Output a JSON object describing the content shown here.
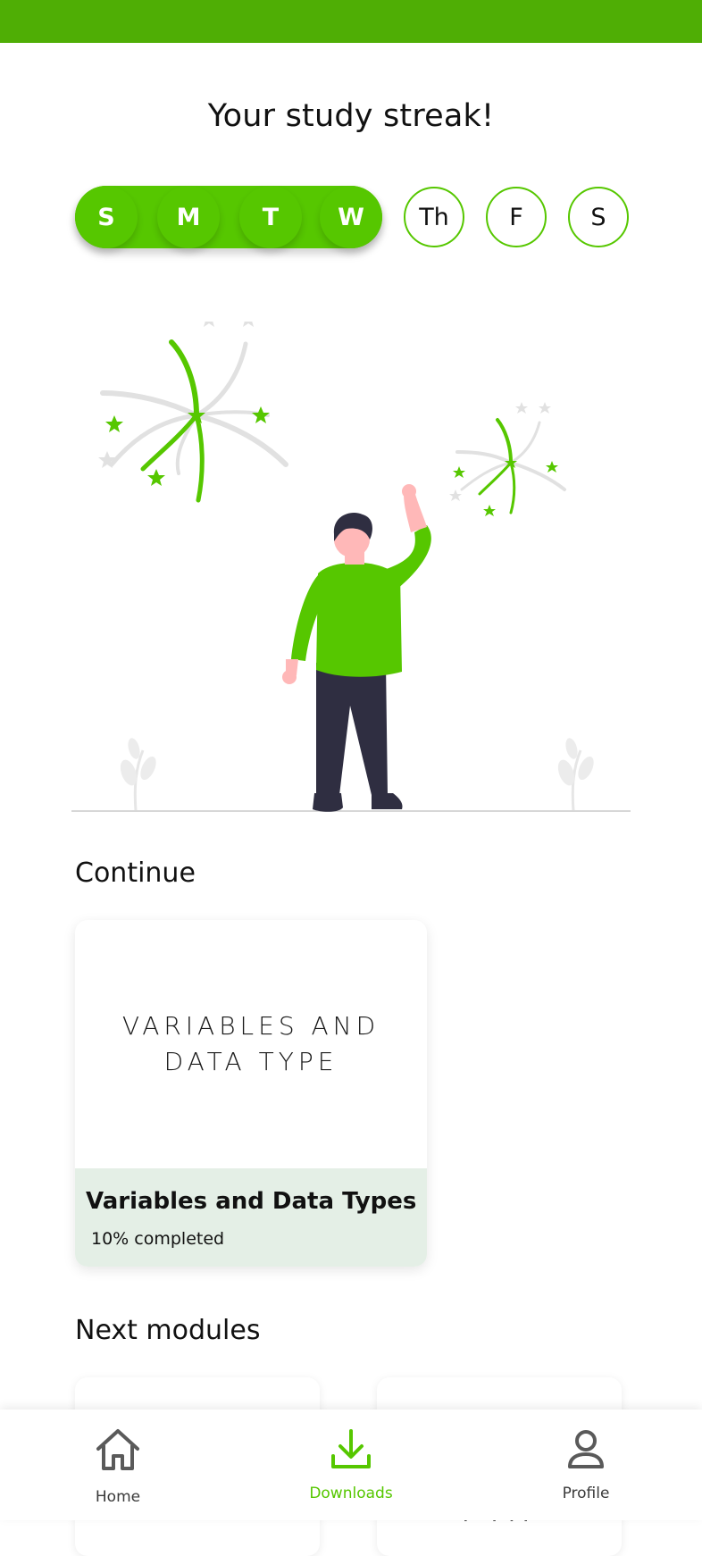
{
  "header": {
    "title": "Your study streak!"
  },
  "streak": {
    "days": [
      {
        "label": "S",
        "done": true
      },
      {
        "label": "M",
        "done": true
      },
      {
        "label": "T",
        "done": true
      },
      {
        "label": "W",
        "done": true
      },
      {
        "label": "Th",
        "done": false
      },
      {
        "label": "F",
        "done": false
      },
      {
        "label": "S",
        "done": false
      }
    ]
  },
  "continue_section": {
    "title": "Continue",
    "card": {
      "thumbnail_text": "VARIABLES AND DATA TYPE",
      "title": "Variables and Data Types",
      "progress_text": "10% completed",
      "progress": 0.1
    }
  },
  "next_section": {
    "title": "Next modules",
    "peek_text": "T TTP"
  },
  "bottom_nav": {
    "items": [
      {
        "label": "Home",
        "icon": "home-icon",
        "active": false
      },
      {
        "label": "Downloads",
        "icon": "download-icon",
        "active": true
      },
      {
        "label": "Profile",
        "icon": "profile-icon",
        "active": false
      }
    ]
  },
  "colors": {
    "top_bar": "#4fae05",
    "accent": "#56c700",
    "card_footer": "#e4efe6",
    "nav_active": "#56c700",
    "nav_inactive": "#5a5a5a"
  }
}
